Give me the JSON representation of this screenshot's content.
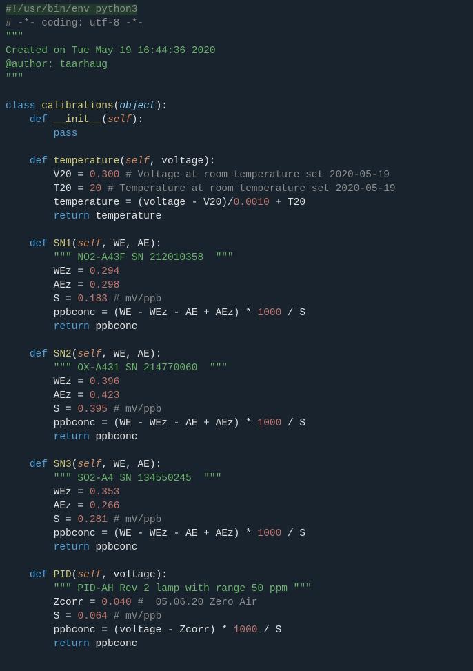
{
  "editor": {
    "shebang": "#!/usr/bin/env python3",
    "coding": "# -*- coding: utf-8 -*-",
    "doc1": "\"\"\"",
    "doc2": "Created on Tue May 19 16:44:36 2020",
    "doc3": "",
    "doc4": "@author: taarhaug",
    "doc5": "\"\"\"",
    "kw_class": "class",
    "classname": "calibrations",
    "lparen": "(",
    "rparen": ")",
    "object": "object",
    "colon": ":",
    "kw_def": "def",
    "kw_return": "return",
    "kw_pass": "pass",
    "self": "self",
    "eq": " = ",
    "init_name": "__init__",
    "temperature": {
      "name": "temperature",
      "args": ", voltage",
      "v20_var": "V20",
      "v20_val": "0.300",
      "v20_comment": "# Voltage at room temperature set 2020-05-19",
      "t20_var": "T20",
      "t20_val": "20",
      "t20_comment": "# Temperature at room temperature set 2020-05-19",
      "assign_var": "temperature",
      "expr_pre": " = (voltage - V20)/",
      "expr_num": "0.0010",
      "expr_post": " + T20",
      "ret_var": "temperature"
    },
    "sn1": {
      "name": "SN1",
      "args": ", WE, AE",
      "doc": "\"\"\" NO2-A43F SN 212010358  \"\"\"",
      "wez_var": "WEz",
      "wez_val": "0.294",
      "aez_var": "AEz",
      "aez_val": "0.298",
      "s_var": "S",
      "s_val": "0.183",
      "s_comment": "# mV/ppb",
      "ppb_var": "ppbconc",
      "ppb_expr": " = (WE - WEz - AE + AEz) * ",
      "ppb_num": "1000",
      "ppb_post": " / S",
      "ret_var": "ppbconc"
    },
    "sn2": {
      "name": "SN2",
      "args": ", WE, AE",
      "doc": "\"\"\" OX-A431 SN 214770060  \"\"\"",
      "wez_var": "WEz",
      "wez_val": "0.396",
      "aez_var": "AEz",
      "aez_val": "0.423",
      "s_var": "S",
      "s_val": "0.395",
      "s_comment": "# mV/ppb",
      "ppb_var": "ppbconc",
      "ppb_expr": " = (WE - WEz - AE + AEz) * ",
      "ppb_num": "1000",
      "ppb_post": " / S",
      "ret_var": "ppbconc"
    },
    "sn3": {
      "name": "SN3",
      "args": ", WE, AE",
      "doc": "\"\"\" SO2-A4 SN 134550245  \"\"\"",
      "wez_var": "WEz",
      "wez_val": "0.353",
      "aez_var": "AEz",
      "aez_val": "0.266",
      "s_var": "S",
      "s_val": "0.281",
      "s_comment": "# mV/ppb",
      "ppb_var": "ppbconc",
      "ppb_expr": " = (WE - WEz - AE + AEz) * ",
      "ppb_num": "1000",
      "ppb_post": " / S",
      "ret_var": "ppbconc"
    },
    "pid": {
      "name": "PID",
      "args": ", voltage",
      "doc": "\"\"\" PID-AH Rev 2 lamp with range 50 ppm \"\"\"",
      "z_var": "Zcorr",
      "z_val": "0.040",
      "z_comment": "#  05.06.20 Zero Air",
      "s_var": "S",
      "s_val": "0.064",
      "s_comment": "# mV/ppb",
      "ppb_var": "ppbconc",
      "ppb_expr": " = (voltage - Zcorr) * ",
      "ppb_num": "1000",
      "ppb_post": " / S",
      "ret_var": "ppbconc"
    }
  }
}
